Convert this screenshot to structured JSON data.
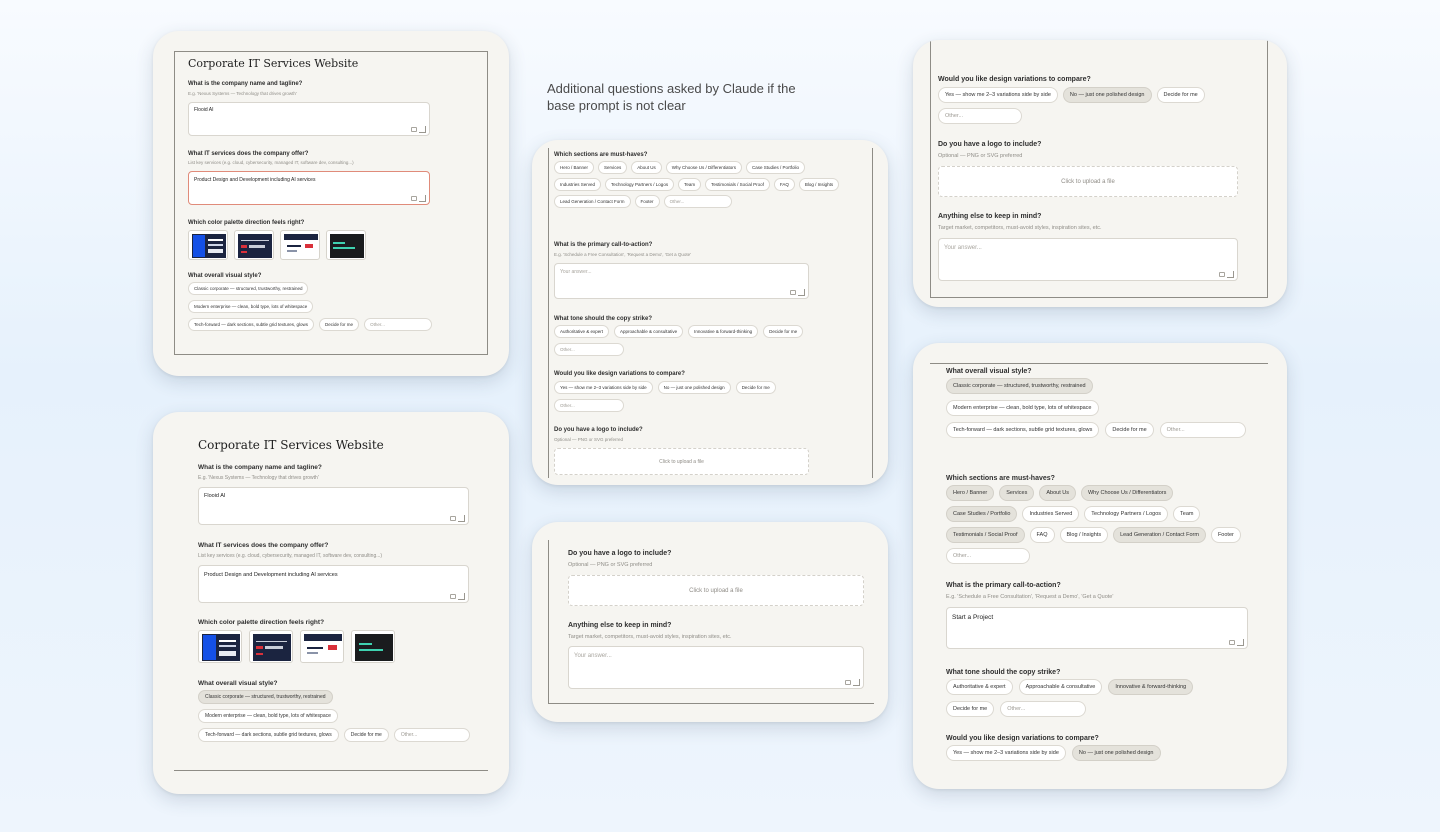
{
  "caption": "Additional questions asked by Claude if the base prompt is not clear",
  "form": {
    "title": "Corporate IT Services Website",
    "company": {
      "question": "What is the company name and tagline?",
      "hint": "E.g. 'Nexus Systems — Technology that drives growth'",
      "value": "Flooid AI"
    },
    "services": {
      "question": "What IT services does the company offer?",
      "hint": "List key services (e.g. cloud, cybersecurity, managed IT, software dev, consulting...)",
      "value": "Product Design and Development including AI services"
    },
    "palette": {
      "question": "Which color palette direction feels right?"
    },
    "style": {
      "question": "What overall visual style?",
      "options": [
        "Classic corporate — structured, trustworthy, restrained",
        "Modern enterprise — clean, bold type, lots of whitespace",
        "Tech-forward — dark sections, subtle grid textures, glows",
        "Decide for me"
      ],
      "other": "Other..."
    },
    "sections": {
      "question": "Which sections are must-haves?",
      "options": [
        "Hero / Banner",
        "Services",
        "About Us",
        "Why Choose Us / Differentiators",
        "Case Studies / Portfolio",
        "Industries Served",
        "Technology Partners / Logos",
        "Team",
        "Testimonials / Social Proof",
        "FAQ",
        "Blog / Insights",
        "Lead Generation / Contact Form",
        "Footer"
      ],
      "other": "Other..."
    },
    "cta": {
      "question": "What is the primary call-to-action?",
      "hint": "E.g. 'Schedule a Free Consultation', 'Request a Demo', 'Get a Quote'",
      "placeholder": "Your answer...",
      "value": "Start a Project"
    },
    "tone": {
      "question": "What tone should the copy strike?",
      "options": [
        "Authoritative & expert",
        "Approachable & consultative",
        "Innovative & forward-thinking",
        "Decide for me"
      ],
      "other": "Other..."
    },
    "variations": {
      "question": "Would you like design variations to compare?",
      "options": [
        "Yes — show me 2–3 variations side by side",
        "No — just one polished design",
        "Decide for me"
      ],
      "other": "Other..."
    },
    "logo": {
      "question": "Do you have a logo to include?",
      "hint": "Optional — PNG or SVG preferred",
      "upload": "Click to upload a file"
    },
    "notes": {
      "question": "Anything else to keep in mind?",
      "hint": "Target market, competitors, must-avoid styles, inspiration sites, etc.",
      "placeholder": "Your answer..."
    }
  },
  "colors": {
    "accent_focus": "#e08b7a",
    "card_bg": "#f6f5f1",
    "chip_selected": "#e4e2db",
    "palette_blue": "#1450e6",
    "palette_navy": "#1b2440",
    "palette_red": "#d9303a",
    "palette_teal": "#3fd2b0"
  }
}
